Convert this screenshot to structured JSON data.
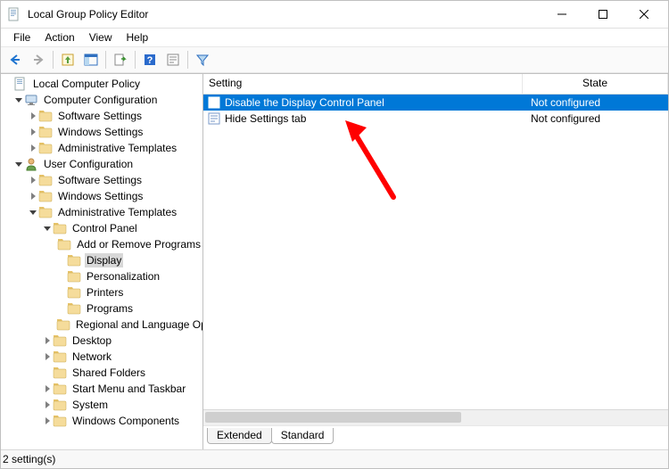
{
  "title": "Local Group Policy Editor",
  "menu": {
    "file": "File",
    "action": "Action",
    "view": "View",
    "help": "Help"
  },
  "tree": {
    "root": "Local Computer Policy",
    "computer_config": "Computer Configuration",
    "cc_software": "Software Settings",
    "cc_windows": "Windows Settings",
    "cc_admin": "Administrative Templates",
    "user_config": "User Configuration",
    "uc_software": "Software Settings",
    "uc_windows": "Windows Settings",
    "uc_admin": "Administrative Templates",
    "control_panel": "Control Panel",
    "cp_add_remove": "Add or Remove Programs",
    "cp_display": "Display",
    "cp_personalization": "Personalization",
    "cp_printers": "Printers",
    "cp_programs": "Programs",
    "cp_regional": "Regional and Language Options",
    "desktop": "Desktop",
    "network": "Network",
    "shared_folders": "Shared Folders",
    "start_menu": "Start Menu and Taskbar",
    "system": "System",
    "windows_components": "Windows Components"
  },
  "columns": {
    "setting": "Setting",
    "state": "State"
  },
  "rows": [
    {
      "name": "Disable the Display Control Panel",
      "state": "Not configured",
      "selected": true
    },
    {
      "name": "Hide Settings tab",
      "state": "Not configured",
      "selected": false
    }
  ],
  "tabs": {
    "extended": "Extended",
    "standard": "Standard"
  },
  "status": "2 setting(s)"
}
